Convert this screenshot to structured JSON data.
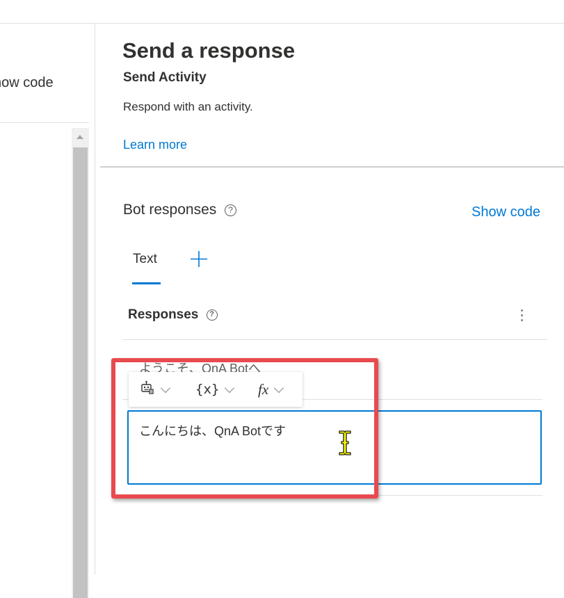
{
  "left_pane": {
    "show_code_label": "how code"
  },
  "header": {
    "title": "Send a response",
    "subtitle": "Send Activity",
    "description": "Respond with an activity.",
    "learn_more": "Learn more"
  },
  "bot_responses": {
    "label": "Bot responses",
    "help": "?",
    "show_code": "Show code",
    "tabs": [
      {
        "label": "Text",
        "selected": true
      }
    ],
    "add_tab_icon": "plus-icon",
    "responses_label": "Responses",
    "responses_help": "?",
    "previous_response": "ようこそ、QnA Botへ",
    "toolbar": {
      "template_icon": "bot-template-icon",
      "variable_label": "{x}",
      "function_label": "fx"
    },
    "current_response": "こんにちは、QnA Botです"
  },
  "colors": {
    "accent": "#0078d4",
    "highlight": "#e84a4f"
  }
}
